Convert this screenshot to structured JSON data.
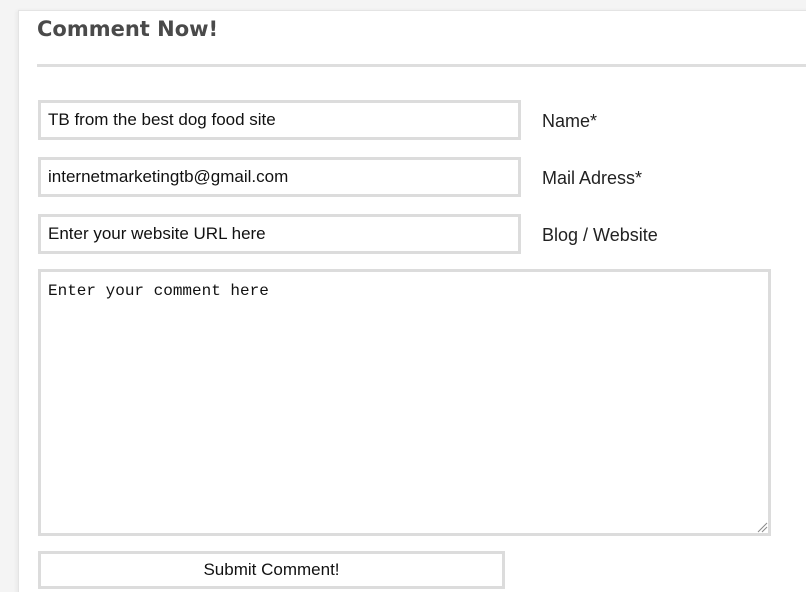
{
  "form": {
    "title": "Comment Now!",
    "fields": [
      {
        "value": "TB from the best dog food site",
        "label": "Name*"
      },
      {
        "value": "internetmarketingtb@gmail.com",
        "label": "Mail Adress*"
      },
      {
        "value": "Enter your website URL here",
        "label": "Blog / Website"
      }
    ],
    "comment": {
      "value": "Enter your comment here"
    },
    "submit_label": "Submit Comment!"
  },
  "colors": {
    "border": "#dcdcdc",
    "title": "#4a4a4a",
    "background": "#ffffff"
  },
  "icons": {
    "resize": "resize-grip-icon"
  }
}
